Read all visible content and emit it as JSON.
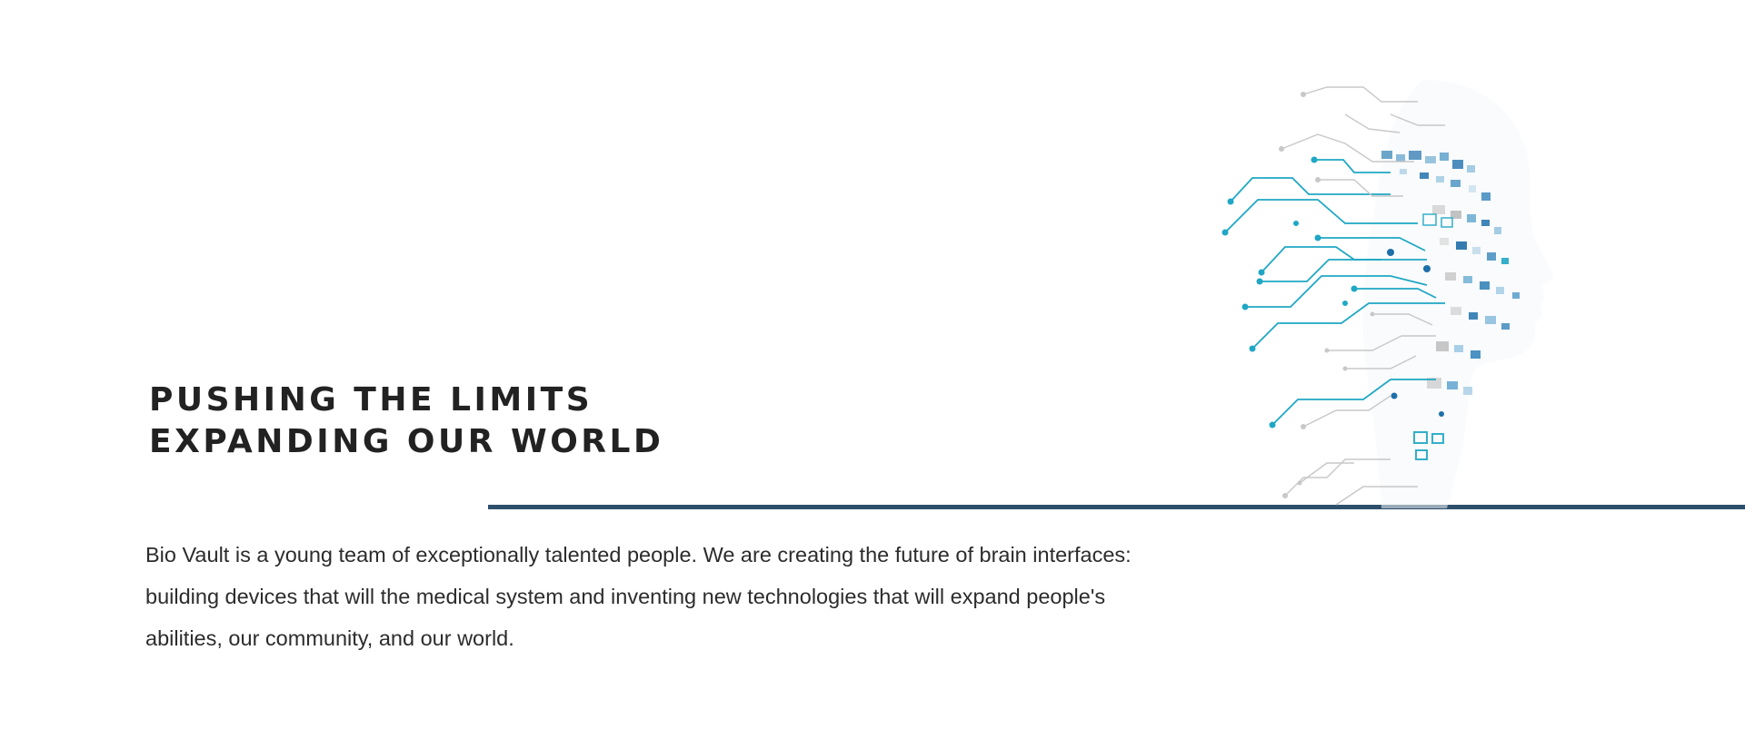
{
  "hero": {
    "title_line_1": "PUSHING THE LIMITS",
    "title_line_2": "EXPANDING OUR WORLD"
  },
  "intro": {
    "line_1": "Bio Vault is a young team of exceptionally talented people. We are creating the future of brain interfaces:",
    "line_2": "building devices that will the medical system and inventing new technologies that will expand people's",
    "line_3": "abilities, our community, and our world."
  },
  "illustration": {
    "icon": "digital-head-circuit-icon",
    "colors": {
      "cyan": "#1fa7c4",
      "blue": "#1f6fa8",
      "grey": "#c8c8c8"
    }
  },
  "theme": {
    "divider_color": "#2e4f6b",
    "text_color": "#2a2a2a"
  }
}
